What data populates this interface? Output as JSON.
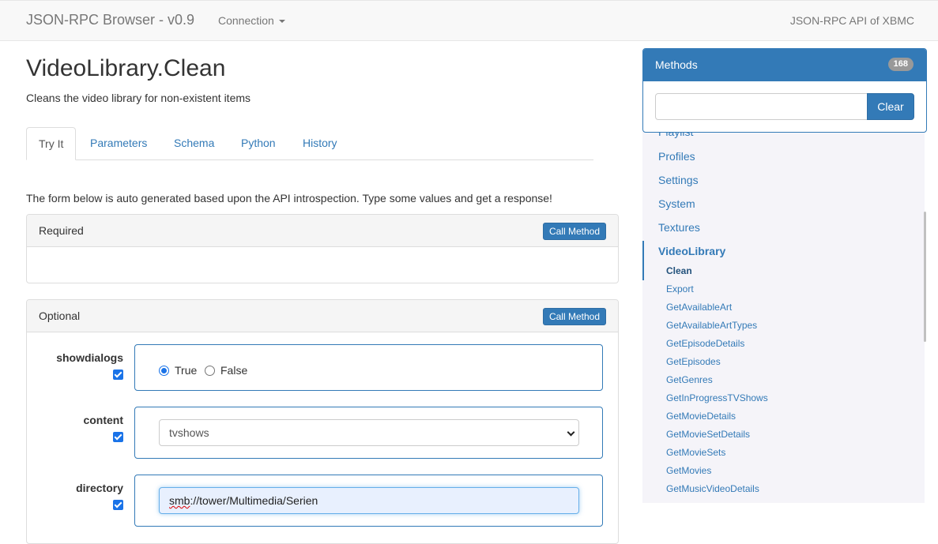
{
  "navbar": {
    "brand": "JSON-RPC Browser - v0.9",
    "connection_label": "Connection",
    "right_text": "JSON-RPC API of XBMC"
  },
  "main": {
    "title": "VideoLibrary.Clean",
    "description": "Cleans the video library for non-existent items",
    "tabs": [
      {
        "label": "Try It"
      },
      {
        "label": "Parameters"
      },
      {
        "label": "Schema"
      },
      {
        "label": "Python"
      },
      {
        "label": "History"
      }
    ],
    "intro": "The form below is auto generated based upon the API introspection. Type some values and get a response!",
    "required_panel": {
      "title": "Required",
      "button": "Call Method"
    },
    "optional_panel": {
      "title": "Optional",
      "button": "Call Method",
      "params": {
        "showdialogs": {
          "label": "showdialogs",
          "true_label": "True",
          "false_label": "False",
          "selected": "True"
        },
        "content": {
          "label": "content",
          "value": "tvshows"
        },
        "directory": {
          "label": "directory",
          "value_prefix": "smb",
          "value_rest": "://tower/Multimedia/Serien"
        }
      }
    }
  },
  "sidebar": {
    "methods_title": "Methods",
    "methods_count": "168",
    "search_placeholder": "",
    "clear_button": "Clear",
    "partial_item": "Playlist",
    "namespaces": [
      "Profiles",
      "Settings",
      "System",
      "Textures"
    ],
    "active_namespace": "VideoLibrary",
    "methods": [
      "Clean",
      "Export",
      "GetAvailableArt",
      "GetAvailableArtTypes",
      "GetEpisodeDetails",
      "GetEpisodes",
      "GetGenres",
      "GetInProgressTVShows",
      "GetMovieDetails",
      "GetMovieSetDetails",
      "GetMovieSets",
      "GetMovies",
      "GetMusicVideoDetails"
    ],
    "active_method": "Clean"
  },
  "colors": {
    "accent": "#337ab7",
    "navbar_bg": "#f8f8f8",
    "sidebar_bg": "#f5f4f9"
  }
}
